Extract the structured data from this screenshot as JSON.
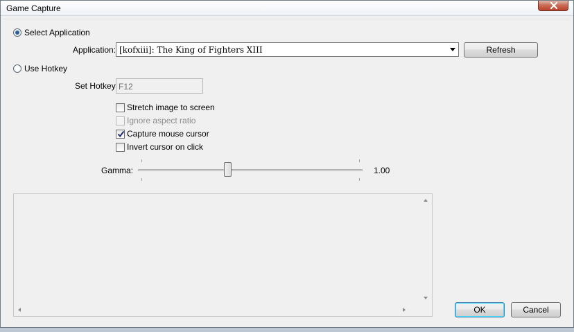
{
  "window": {
    "title": "Game Capture"
  },
  "source": {
    "select_application_label": "Select Application",
    "select_application_checked": true,
    "application_label": "Application:",
    "application_value": "[kofxiii]: The King of Fighters XIII",
    "refresh_label": "Refresh",
    "use_hotkey_label": "Use Hotkey",
    "use_hotkey_checked": false,
    "set_hotkey_label": "Set Hotkey",
    "hotkey_value": "F12"
  },
  "options": {
    "stretch_label": "Stretch image to screen",
    "stretch_checked": false,
    "ignore_aspect_label": "Ignore aspect ratio",
    "ignore_aspect_checked": false,
    "capture_cursor_label": "Capture mouse cursor",
    "capture_cursor_checked": true,
    "invert_cursor_label": "Invert cursor on click",
    "invert_cursor_checked": false
  },
  "gamma": {
    "label": "Gamma:",
    "value_text": "1.00",
    "slider_fraction": 0.4
  },
  "footer": {
    "ok_label": "OK",
    "cancel_label": "Cancel"
  }
}
